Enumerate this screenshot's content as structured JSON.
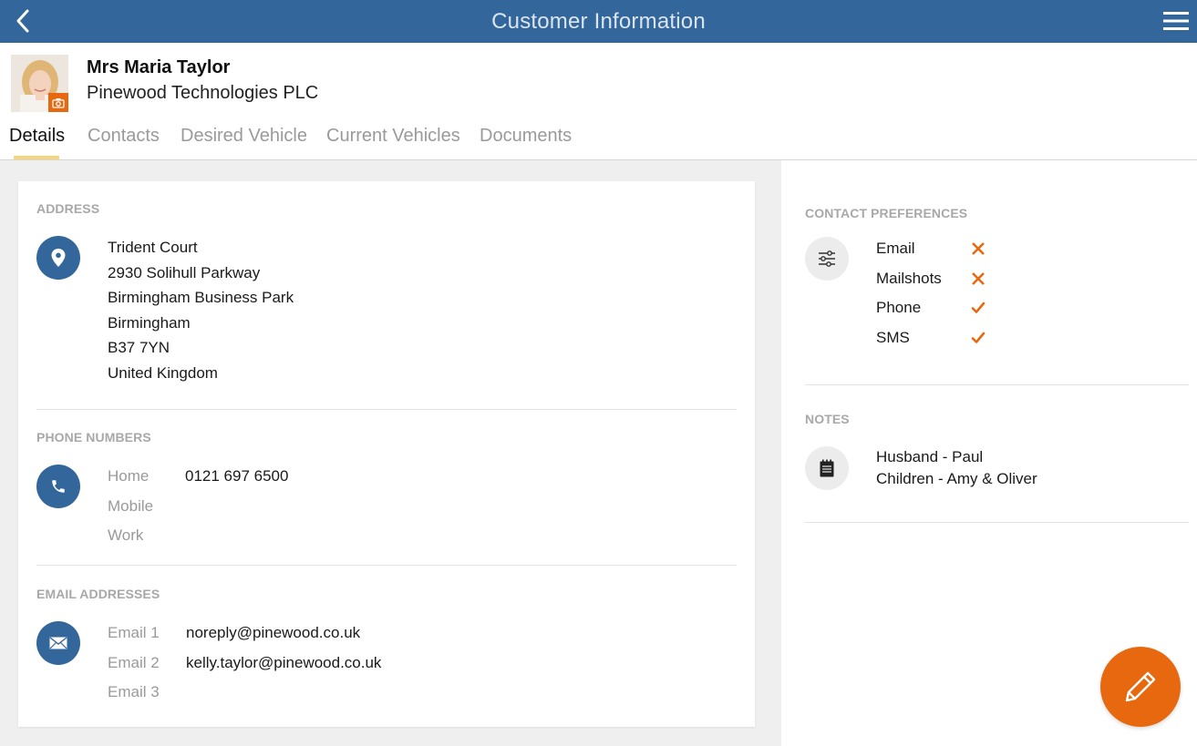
{
  "header": {
    "title": "Customer Information",
    "color": "#33669a"
  },
  "profile": {
    "name": "Mrs Maria Taylor",
    "company": "Pinewood Technologies PLC"
  },
  "tabs": [
    {
      "label": "Details",
      "active": true
    },
    {
      "label": "Contacts",
      "active": false
    },
    {
      "label": "Desired Vehicle",
      "active": false
    },
    {
      "label": "Current Vehicles",
      "active": false
    },
    {
      "label": "Documents",
      "active": false
    }
  ],
  "address": {
    "title": "ADDRESS",
    "lines": [
      "Trident Court",
      "2930 Solihull Parkway",
      "Birmingham Business Park",
      "Birmingham",
      "B37 7YN",
      "United Kingdom"
    ]
  },
  "phones": {
    "title": "PHONE NUMBERS",
    "rows": [
      {
        "label": "Home",
        "value": "0121 697 6500"
      },
      {
        "label": "Mobile",
        "value": ""
      },
      {
        "label": "Work",
        "value": ""
      }
    ]
  },
  "emails": {
    "title": "EMAIL ADDRESSES",
    "rows": [
      {
        "label": "Email 1",
        "value": "noreply@pinewood.co.uk"
      },
      {
        "label": "Email 2",
        "value": "kelly.taylor@pinewood.co.uk"
      },
      {
        "label": "Email 3",
        "value": ""
      }
    ]
  },
  "contact_preferences": {
    "title": "CONTACT PREFERENCES",
    "items": [
      {
        "label": "Email",
        "allowed": false
      },
      {
        "label": "Mailshots",
        "allowed": false
      },
      {
        "label": "Phone",
        "allowed": true
      },
      {
        "label": "SMS",
        "allowed": true
      }
    ]
  },
  "notes": {
    "title": "NOTES",
    "lines": [
      "Husband - Paul",
      "Children - Amy & Oliver"
    ]
  },
  "icons": {
    "back": "chevron-left-icon",
    "menu": "hamburger-menu-icon",
    "camera": "camera-icon",
    "address": "map-pin-icon",
    "phone": "phone-icon",
    "email": "envelope-icon",
    "preferences": "sliders-icon",
    "notes": "notepad-icon",
    "edit": "pencil-icon"
  },
  "colors": {
    "accent": "#e8680f",
    "tab_indicator": "#f6d47a"
  }
}
